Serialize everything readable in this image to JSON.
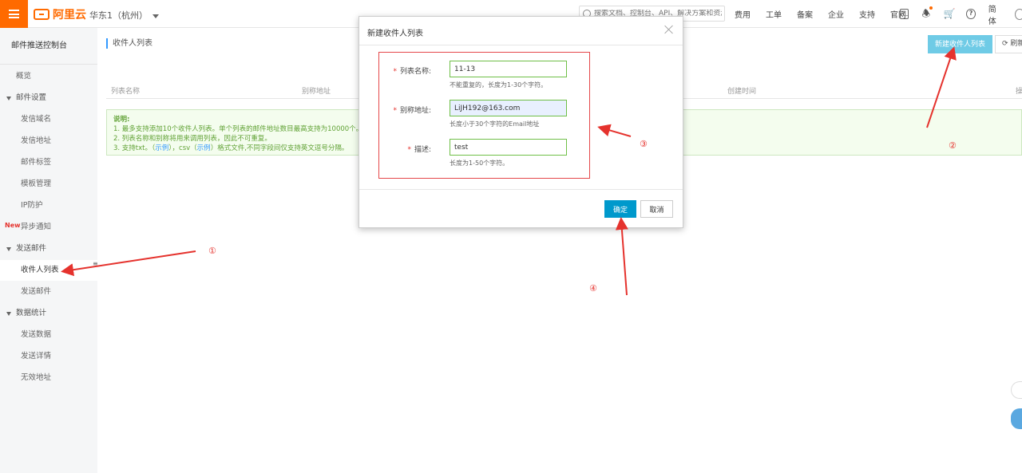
{
  "topbar": {
    "logo_text": "阿里云",
    "region": "华东1（杭州）",
    "search_placeholder": "搜索文档、控制台、API、解决方案和资源",
    "nav": [
      "费用",
      "工单",
      "备案",
      "企业",
      "支持",
      "官网"
    ],
    "lang": "简体"
  },
  "sidebar": {
    "title": "邮件推送控制台",
    "overview": "概览",
    "group_mail_settings": "邮件设置",
    "items_mail_settings": [
      "发信域名",
      "发信地址",
      "邮件标签",
      "模板管理",
      "IP防护",
      "异步通知"
    ],
    "new_tag": "New",
    "group_send_mail": "发送邮件",
    "items_send_mail": [
      "收件人列表",
      "发送邮件"
    ],
    "group_stats": "数据统计",
    "items_stats": [
      "发送数据",
      "发送详情",
      "无效地址"
    ]
  },
  "main": {
    "title": "收件人列表",
    "new_button": "新建收件人列表",
    "refresh_button": "刷新",
    "columns": [
      "列表名称",
      "别称地址",
      "创建时间",
      "操"
    ],
    "notice": {
      "title": "说明:",
      "line1": "1. 最多支持添加10个收件人列表。单个列表的邮件地址数目最高支持为10000个。最多",
      "line2": "2. 列表名称和别称将用来调用列表，因此不可重复。",
      "line3_a": "3. 支持txt。（",
      "line3_link1": "示例",
      "line3_b": "），csv（",
      "line3_link2": "示例",
      "line3_c": "）格式文件,不同字段间仅支持英文逗号分隔。"
    }
  },
  "dialog": {
    "title": "新建收件人列表",
    "fields": [
      {
        "label": "列表名称:",
        "value": "11-13",
        "hint": "不能重复的，长度为1-30个字符。",
        "required": "*"
      },
      {
        "label": "别称地址:",
        "value": "LiJH192@163.com",
        "hint": "长度小于30个字符的Email地址",
        "required": "*"
      },
      {
        "label": "描述:",
        "value": "test",
        "hint": "长度为1-50个字符。",
        "required": "*"
      }
    ],
    "ok": "确定",
    "cancel": "取消"
  },
  "annotations": {
    "step1": "①",
    "step2": "②",
    "step3": "③",
    "step4": "④",
    "color": "#e5322d"
  }
}
